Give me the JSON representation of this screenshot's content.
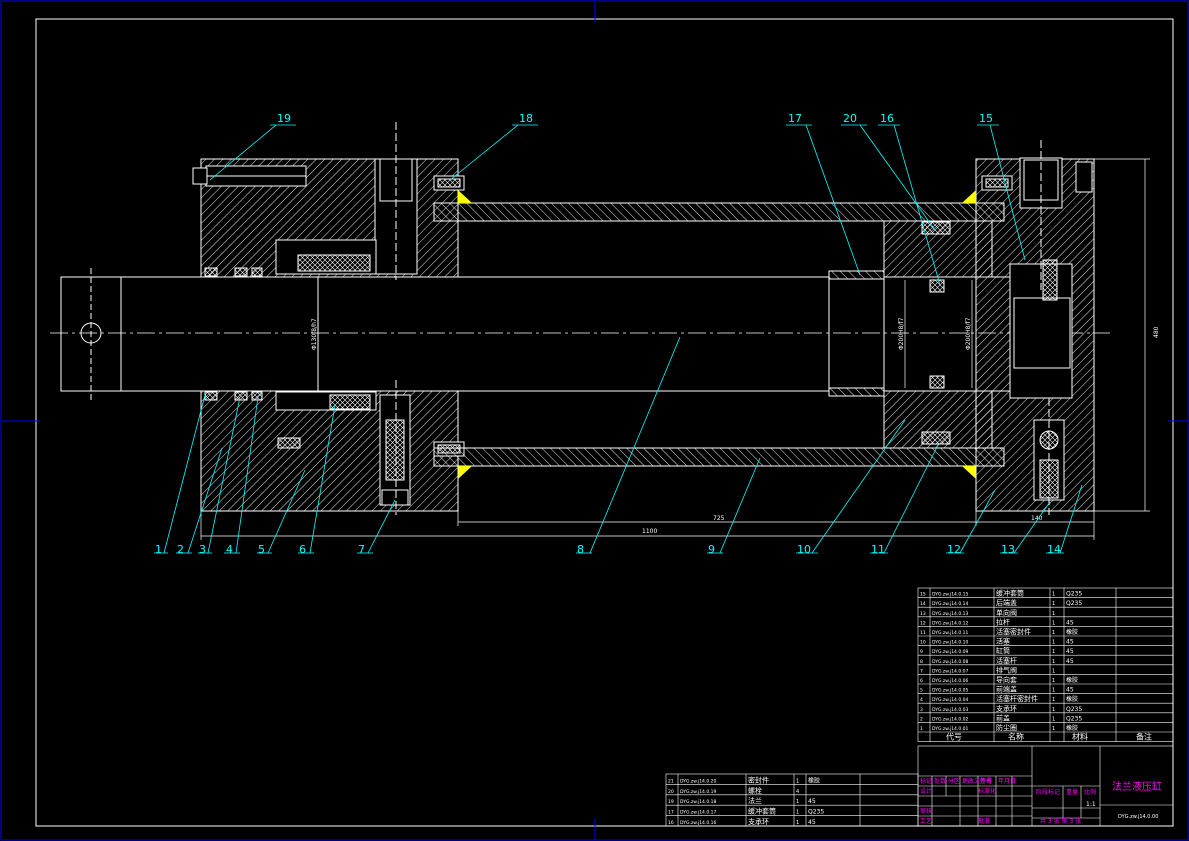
{
  "balloons": {
    "top": [
      "19",
      "18",
      "17",
      "20",
      "16",
      "15"
    ],
    "bottom": [
      "1",
      "2",
      "3",
      "4",
      "5",
      "6",
      "7",
      "8",
      "9",
      "10",
      "11",
      "12",
      "13",
      "14"
    ]
  },
  "dimensions": {
    "total_length": "1100",
    "stroke": "725",
    "end_gap": "140",
    "overall_height": "480",
    "rod_dia": "Φ130f8/h7",
    "piston_dia": "Φ200H8/f7",
    "piston_dia2": "Φ200H8/f7"
  },
  "parts_list": {
    "header": {
      "code": "代号",
      "name": "名称",
      "qty": "",
      "material": "材料",
      "remark": "备注"
    },
    "rows": [
      {
        "no": "15",
        "code": "DYG.zw.j14.0.15",
        "name": "缓冲套筒",
        "qty": "1",
        "material": "Q235"
      },
      {
        "no": "14",
        "code": "DYG.zw.j14.0.14",
        "name": "后端盖",
        "qty": "1",
        "material": "Q235"
      },
      {
        "no": "13",
        "code": "DYG.zw.j14.0.13",
        "name": "单向阀",
        "qty": "1",
        "material": ""
      },
      {
        "no": "12",
        "code": "DYG.zw.j14.0.12",
        "name": "拉杆",
        "qty": "1",
        "material": "45"
      },
      {
        "no": "11",
        "code": "DYG.zw.j14.0.11",
        "name": "活塞密封件",
        "qty": "1",
        "material": "橡胶"
      },
      {
        "no": "10",
        "code": "DYG.zw.j14.0.10",
        "name": "活塞",
        "qty": "1",
        "material": "45"
      },
      {
        "no": "9",
        "code": "DYG.zw.j14.0.09",
        "name": "缸筒",
        "qty": "1",
        "material": "45"
      },
      {
        "no": "8",
        "code": "DYG.zw.j14.0.08",
        "name": "活塞杆",
        "qty": "1",
        "material": "45"
      },
      {
        "no": "7",
        "code": "DYG.zw.j14.0.07",
        "name": "排气阀",
        "qty": "1",
        "material": ""
      },
      {
        "no": "6",
        "code": "DYG.zw.j14.0.06",
        "name": "导向套",
        "qty": "1",
        "material": "橡胶"
      },
      {
        "no": "5",
        "code": "DYG.zw.j14.0.05",
        "name": "前端盖",
        "qty": "1",
        "material": "45"
      },
      {
        "no": "4",
        "code": "DYG.zw.j14.0.04",
        "name": "活塞杆密封件",
        "qty": "1",
        "material": "橡胶"
      },
      {
        "no": "3",
        "code": "DYG.zw.j14.0.03",
        "name": "支承环",
        "qty": "1",
        "material": "Q235"
      },
      {
        "no": "2",
        "code": "DYG.zw.j14.0.02",
        "name": "前盖",
        "qty": "1",
        "material": "Q235"
      },
      {
        "no": "1",
        "code": "DYG.zw.j14.0.01",
        "name": "防尘圈",
        "qty": "1",
        "material": "橡胶"
      }
    ]
  },
  "parts_list_2": {
    "rows": [
      {
        "no": "21",
        "code": "DYG.zw.j14.0.20",
        "name": "密封件",
        "qty": "1",
        "material": "橡胶"
      },
      {
        "no": "20",
        "code": "DYG.zw.j14.0.19",
        "name": "螺栓",
        "qty": "4",
        "material": ""
      },
      {
        "no": "19",
        "code": "DYG.zw.j14.0.18",
        "name": "法兰",
        "qty": "1",
        "material": "45"
      },
      {
        "no": "17",
        "code": "DYG.zw.j14.0.17",
        "name": "缓冲套筒",
        "qty": "1",
        "material": "Q235"
      },
      {
        "no": "16",
        "code": "DYG.zw.j14.0.16",
        "name": "支承环",
        "qty": "1",
        "material": "45"
      }
    ]
  },
  "title_block": {
    "title": "法兰液压缸",
    "drawing_no": "DYG.zw.j14.0.00",
    "scale": "比例",
    "weight": "重量",
    "stage": "阶段标记",
    "sheet": "共 3 张 第 3 张",
    "labels": [
      "标记",
      "处数",
      "分区",
      "更改文件号",
      "签名",
      "年月日"
    ],
    "design": "设计",
    "check": "审核",
    "process": "工艺",
    "standard": "标准化",
    "approve": "批准",
    "scale_value": "1:1",
    "sum_label": "总计"
  },
  "colors": {
    "background": "#000000",
    "frame": "#ffffff",
    "balloon": "#00ffff",
    "hatch": "#ffffff",
    "title_text": "#ff00ff",
    "accent_yellow": "#ffff00",
    "sheet_edge": "#0000ff"
  }
}
